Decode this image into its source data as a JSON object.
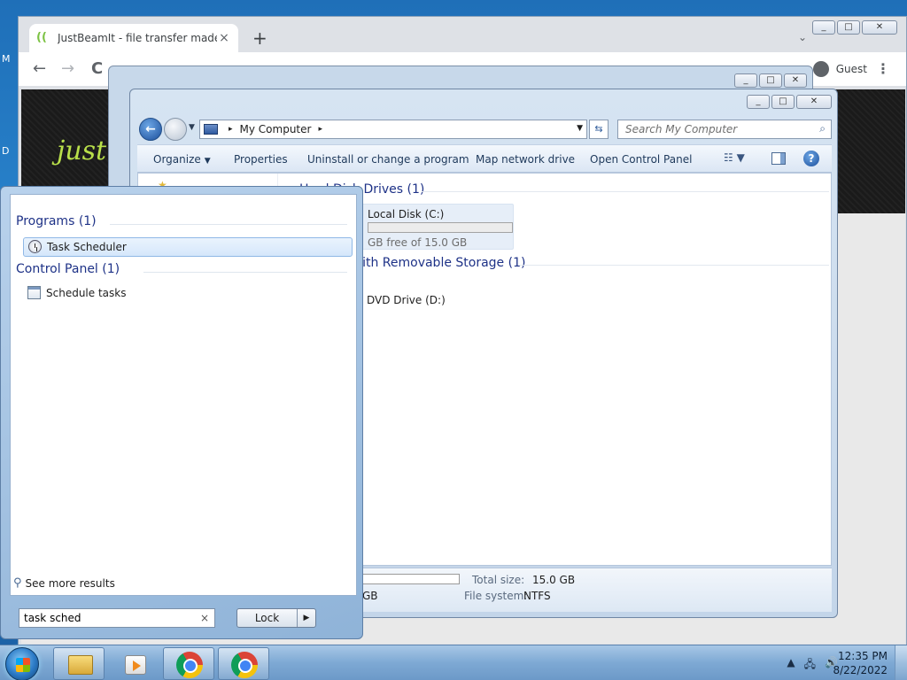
{
  "desktop": {
    "glyph_m": "M",
    "glyph_d": "D"
  },
  "chrome": {
    "tab_title": "JustBeamIt - file transfer made e...",
    "tab_close": "×",
    "new_tab": "+",
    "tab_search": "⌄",
    "back": "←",
    "forward": "→",
    "reload": "C",
    "profile_label": "Guest",
    "menu": "⋮",
    "page_logo": "just",
    "ctrl_min": "_",
    "ctrl_max": "□",
    "ctrl_close": "✕"
  },
  "explorer": {
    "address_location": "My Computer",
    "address_sep": "▸",
    "search_placeholder": "Search My Computer",
    "search_icon": "⌕",
    "refresh_icon": "⇆",
    "commands": {
      "organize": "Organize",
      "properties": "Properties",
      "uninstall": "Uninstall or change a program",
      "map_drive": "Map network drive",
      "control_panel": "Open Control Panel"
    },
    "views_icon": "☷",
    "help_icon": "?",
    "groups": {
      "hdd_header": "Hard Disk Drives (1)",
      "removable_header": "Devices with Removable Storage (1)"
    },
    "drive_c": {
      "name": "Local Disk (C:)",
      "free_text": "GB free of 15.0 GB",
      "used_fraction": 0.0
    },
    "drive_d": {
      "name": "DVD Drive (D:)"
    },
    "details": {
      "space_used_value": "GB",
      "total_size_label": "Total size:",
      "total_size_value": "15.0 GB",
      "fs_label": "File system:",
      "fs_value": "NTFS",
      "used_fraction": 0.0
    }
  },
  "start_menu": {
    "programs_header": "Programs (1)",
    "programs_item": "Task Scheduler",
    "cp_header": "Control Panel (1)",
    "cp_item": "Schedule tasks",
    "see_more": "See more results",
    "search_value": "task sched",
    "clear_icon": "×",
    "lock_label": "Lock",
    "lock_arrow": "▶"
  },
  "taskbar": {
    "tray_arrow": "▲",
    "tray_net": "🖧",
    "tray_vol": "🔊",
    "time": "12:35 PM",
    "date": "8/22/2022"
  }
}
